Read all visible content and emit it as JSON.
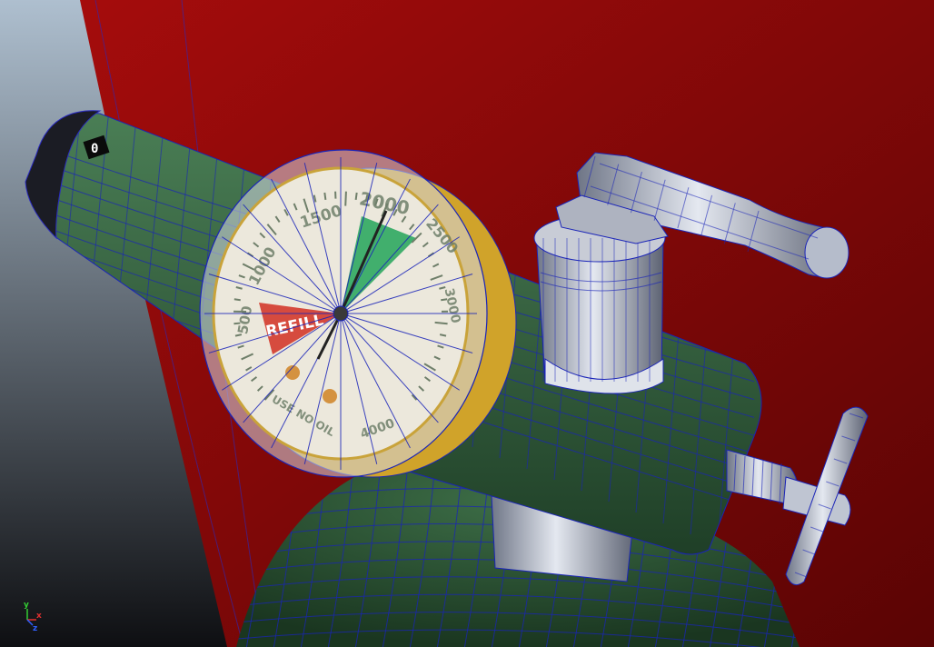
{
  "viewport": {
    "shading": "wireframe-on-shaded",
    "background": {
      "top": "#aebfcf",
      "bottom": "#0e0f12"
    },
    "wire_color": "#1a24b8"
  },
  "scene": {
    "wall": {
      "color": "#8a0a0a"
    },
    "cylinder": {
      "color": "#2f5a38"
    },
    "regulator": {
      "body_color": "#3a6a45",
      "metal_color": "#9ea6b6"
    },
    "gauge": {
      "face_color": "#ece8dc",
      "bezel_color": "#d0a32a",
      "refill_label": "REFILL",
      "refill_color": "#d43a2c",
      "safe_color": "#2fa860",
      "scale_labels": [
        "2000",
        "1500",
        "1000",
        "500",
        "2500",
        "3000",
        "4000"
      ],
      "warning_text": "USE NO OIL",
      "end_cap_mark": "0"
    }
  },
  "axis_gizmo": {
    "x": "x",
    "y": "y",
    "z": "z"
  }
}
